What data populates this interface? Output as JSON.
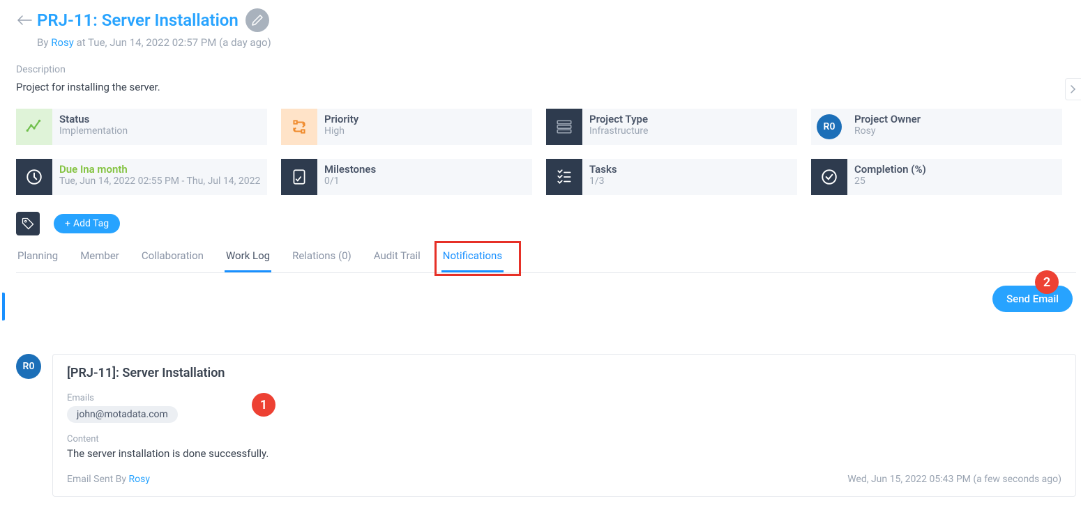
{
  "header": {
    "title": "PRJ-11: Server Installation",
    "by_label": "By",
    "author": "Rosy",
    "at": "at Tue, Jun 14, 2022 02:57 PM (a day ago)"
  },
  "description": {
    "label": "Description",
    "text": "Project for installing the server."
  },
  "cards": {
    "status": {
      "label": "Status",
      "value": "Implementation"
    },
    "priority": {
      "label": "Priority",
      "value": "High"
    },
    "project_type": {
      "label": "Project Type",
      "value": "Infrastructure"
    },
    "project_owner": {
      "label": "Project Owner",
      "value": "Rosy",
      "avatar": "R0"
    },
    "due": {
      "label": "Due Ina month",
      "value": "Tue, Jun 14, 2022 02:55 PM - Thu, Jul 14, 2022"
    },
    "milestones": {
      "label": "Milestones",
      "value": "0/1"
    },
    "tasks": {
      "label": "Tasks",
      "value": "1/3"
    },
    "completion": {
      "label": "Completion (%)",
      "value": "25"
    }
  },
  "tag_button": "Add Tag",
  "tabs": {
    "planning": "Planning",
    "member": "Member",
    "collaboration": "Collaboration",
    "work_log": "Work Log",
    "relations": "Relations (0)",
    "audit_trail": "Audit Trail",
    "notifications": "Notifications"
  },
  "send_email_button": "Send Email",
  "annotations": {
    "one": "1",
    "two": "2"
  },
  "notification": {
    "avatar": "R0",
    "subject": "[PRJ-11]: Server Installation",
    "emails_label": "Emails",
    "email_chip": "john@motadata.com",
    "content_label": "Content",
    "content_text": "The server installation is done successfully.",
    "sent_by_label": "Email Sent By ",
    "sent_by": "Rosy",
    "timestamp": "Wed, Jun 15, 2022 05:43 PM (a few seconds ago)"
  }
}
